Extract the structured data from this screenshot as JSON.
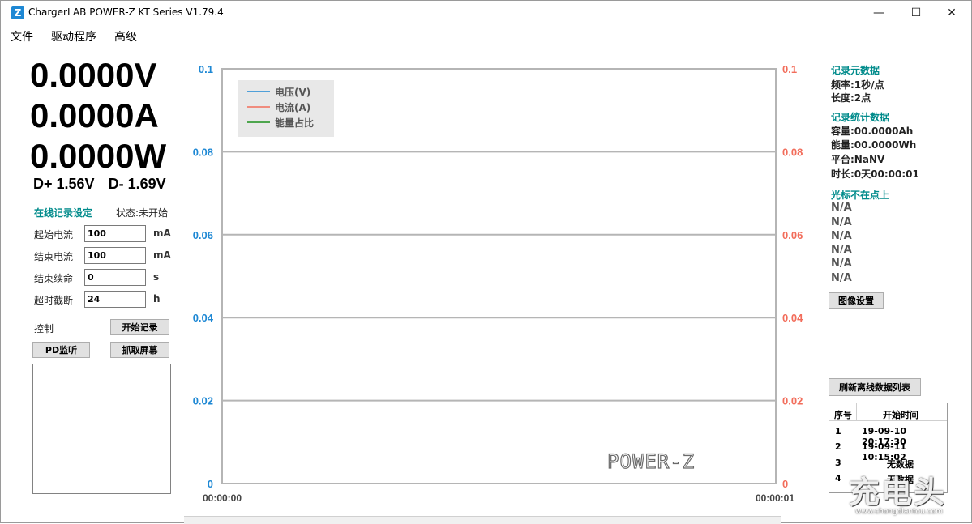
{
  "window": {
    "title": "ChargerLAB POWER-Z KT Series V1.79.4",
    "icon_letter": "Z",
    "min_glyph": "—",
    "max_glyph": "☐",
    "close_glyph": "✕"
  },
  "menu": [
    "文件",
    "驱动程序",
    "高级"
  ],
  "readings": {
    "voltage": "0.0000V",
    "current": "0.0000A",
    "power": "0.0000W",
    "dplus": "D+ 1.56V",
    "dminus": "D- 1.69V"
  },
  "online_record": {
    "title": "在线记录设定",
    "status": "状态:未开始",
    "fields": [
      {
        "label": "起始电流",
        "value": "100",
        "unit": "mA"
      },
      {
        "label": "结束电流",
        "value": "100",
        "unit": "mA"
      },
      {
        "label": "结束续命",
        "value": "0",
        "unit": "s"
      },
      {
        "label": "超时截断",
        "value": "24",
        "unit": "h"
      }
    ],
    "control_label": "控制",
    "start_button": "开始记录",
    "pd_button": "PD监听",
    "capture_button": "抓取屏幕"
  },
  "chart_data": {
    "type": "line",
    "left_ticks": [
      "0.1",
      "0.08",
      "0.06",
      "0.04",
      "0.02",
      "0"
    ],
    "right_ticks": [
      "0.1",
      "0.08",
      "0.06",
      "0.04",
      "0.02",
      "0"
    ],
    "x_ticks": [
      "00:00:00",
      "00:00:01"
    ],
    "ylim": [
      0,
      0.1
    ],
    "grid": true,
    "legend_position": "top-left",
    "legend": [
      {
        "name": "电压(V)",
        "color": "#1e88d4"
      },
      {
        "name": "电流(A)",
        "color": "#f26d5b"
      },
      {
        "name": "能量占比",
        "color": "#1a8f1a"
      }
    ],
    "series": [],
    "left_axis_color": "#1e88d4",
    "right_axis_color": "#f26d5b",
    "logo": "POWER-Z"
  },
  "record_meta": {
    "title": "记录元数据",
    "freq": "频率:1秒/点",
    "length": "长度:2点"
  },
  "record_stats": {
    "title": "记录统计数据",
    "capacity": "容量:00.0000Ah",
    "energy": "能量:00.0000Wh",
    "platform": "平台:NaNV",
    "duration": "时长:0天00:00:01"
  },
  "cursor": {
    "title": "光标不在点上",
    "values": [
      "N/A",
      "N/A",
      "N/A",
      "N/A",
      "N/A",
      "N/A"
    ]
  },
  "image_settings_button": "图像设置",
  "refresh_button": "刷新离线数据列表",
  "offline_table": {
    "headers": [
      "序号",
      "开始时间"
    ],
    "rows": [
      {
        "idx": "1",
        "time": "19-09-10 20:17:30"
      },
      {
        "idx": "2",
        "time": "19-09-11 10:15:02"
      },
      {
        "idx": "3",
        "time": "无数据"
      },
      {
        "idx": "4",
        "time": "无数据"
      }
    ]
  },
  "watermark": {
    "big": "充电头",
    "small": "www.chongdiantou.com"
  }
}
